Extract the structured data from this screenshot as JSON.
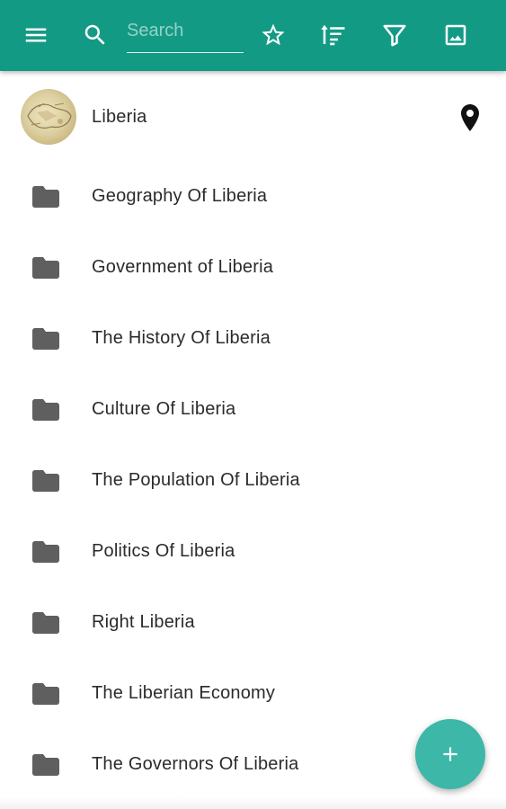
{
  "toolbar": {
    "color": "#139a85",
    "menu_icon": "menu-icon",
    "search_icon": "search-icon",
    "search_placeholder": "Search",
    "actions": [
      "star-icon",
      "sort-icon",
      "filter-icon",
      "image-icon"
    ]
  },
  "header_item": {
    "label": "Liberia",
    "avatar": "map-thumbnail",
    "trailing_icon": "location-pin-icon"
  },
  "folders": [
    {
      "label": "Geography Of Liberia"
    },
    {
      "label": "Government of Liberia"
    },
    {
      "label": "The History Of Liberia"
    },
    {
      "label": "Culture Of Liberia"
    },
    {
      "label": "The Population Of Liberia"
    },
    {
      "label": "Politics Of Liberia"
    },
    {
      "label": "Right Liberia"
    },
    {
      "label": "The Liberian Economy"
    },
    {
      "label": "The Governors Of Liberia"
    }
  ],
  "fab": {
    "icon": "plus-icon",
    "color": "#3cb7a8"
  }
}
